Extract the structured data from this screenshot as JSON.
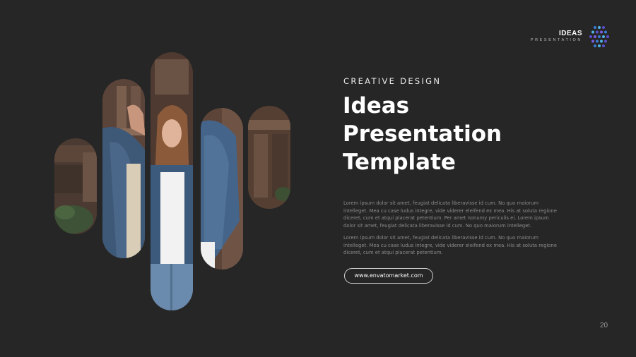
{
  "logo": {
    "title": "IDEAS",
    "subtitle": "PRESENTATION",
    "dot_colors": [
      "#3a7bd5",
      "#4fb3e8",
      "#5a4fcf",
      "#7a5fe0"
    ]
  },
  "eyebrow": "CREATIVE DESIGN",
  "title_lines": [
    "Ideas",
    "Presentation",
    "Template"
  ],
  "paragraphs": [
    "Lorem ipsum dolor sit amet, feugiat delicata liberavisse id cum. No quo maiorum intelleget. Mea cu case ludus integre, vide viderer eleifend ex mea. His at soluta regione diceret, cum et atqui placerat petentium. Per amet nonumy periculis ei. Lorem ipsum dolor sit amet, feugiat delicata liberavisse id cum. No quo maiorum intelleget.",
    "Lorem ipsum dolor sit amet, feugiat delicata liberavisse id cum. No quo maiorum intelleget. Mea cu case ludus integre, vide viderer eleifend ex mea. His at soluta regione diceret, cum et atqui placerat petentium."
  ],
  "url_button": "www.envatomarket.com",
  "page_number": "20",
  "colors": {
    "background": "#262626",
    "title": "#ffffff",
    "body_text": "#8c8c8c"
  }
}
